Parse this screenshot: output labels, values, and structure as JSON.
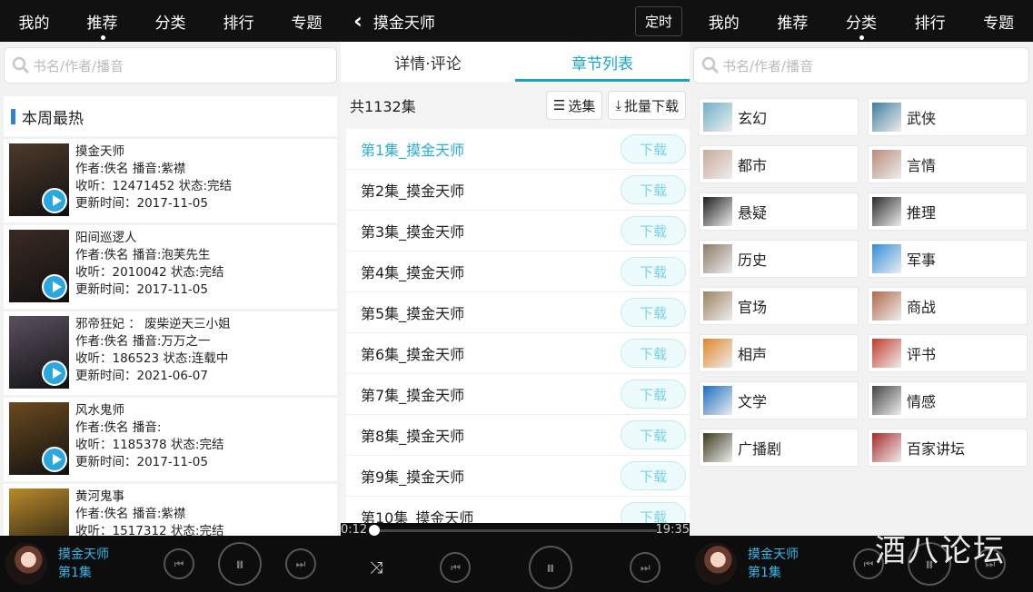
{
  "left": {
    "nav": [
      "我的",
      "推荐",
      "分类",
      "排行",
      "专题"
    ],
    "search_placeholder": "书名/作者/播音",
    "hot_title": "本周最热",
    "books": [
      {
        "title": "摸金天师",
        "author": "作者:佚名 播音:紫襟",
        "listen": "收听：12471452 状态:完结",
        "update": "更新时间：2017-11-05",
        "color": "#4d3a2a"
      },
      {
        "title": "阳间巡逻人",
        "author": "作者:佚名 播音:泡芙先生",
        "listen": "收听：2010042 状态:完结",
        "update": "更新时间：2017-11-05",
        "color": "#3a2a24"
      },
      {
        "title": "邪帝狂妃 ： 废柴逆天三小姐",
        "author": "作者:佚名 播音:万万之一",
        "listen": "收听：186523 状态:连载中",
        "update": "更新时间：2021-06-07",
        "color": "#5a5060"
      },
      {
        "title": "风水鬼师",
        "author": "作者:佚名 播音:",
        "listen": "收听：1185378 状态:完结",
        "update": "更新时间：2017-11-05",
        "color": "#6b4a1e"
      },
      {
        "title": "黄河鬼事",
        "author": "作者:佚名 播音:紫襟",
        "listen": "收听：1517312 状态:完结",
        "update": "",
        "color": "#b98a2a"
      }
    ],
    "player": {
      "title": "摸金天师",
      "episode": "第1集"
    }
  },
  "middle": {
    "title": "摸金天师",
    "timer": "定时",
    "tabs": [
      "详情·评论",
      "章节列表"
    ],
    "count": "共1132集",
    "select_btn": "选集",
    "batch_btn": "批量下载",
    "episodes": [
      "第1集_摸金天师",
      "第2集_摸金天师",
      "第3集_摸金天师",
      "第4集_摸金天师",
      "第5集_摸金天师",
      "第6集_摸金天师",
      "第7集_摸金天师",
      "第8集_摸金天师",
      "第9集_摸金天师",
      "第10集_摸金天师"
    ],
    "download_label": "下载",
    "progress": {
      "current": "0:12",
      "total": "19:35"
    }
  },
  "right": {
    "nav": [
      "我的",
      "推荐",
      "分类",
      "排行",
      "专题"
    ],
    "search_placeholder": "书名/作者/播音",
    "categories": [
      {
        "name": "玄幻",
        "color": "#6fb1c9"
      },
      {
        "name": "武侠",
        "color": "#3e7fa0"
      },
      {
        "name": "都市",
        "color": "#c9a99a"
      },
      {
        "name": "言情",
        "color": "#b98c7a"
      },
      {
        "name": "悬疑",
        "color": "#1e1e1e"
      },
      {
        "name": "推理",
        "color": "#2a2a2a"
      },
      {
        "name": "历史",
        "color": "#8b7b66"
      },
      {
        "name": "军事",
        "color": "#2f8fd8"
      },
      {
        "name": "官场",
        "color": "#9c8460"
      },
      {
        "name": "商战",
        "color": "#b0694a"
      },
      {
        "name": "相声",
        "color": "#e0852a"
      },
      {
        "name": "评书",
        "color": "#c23b2a"
      },
      {
        "name": "文学",
        "color": "#1a6fc0"
      },
      {
        "name": "情感",
        "color": "#444444"
      },
      {
        "name": "广播剧",
        "color": "#3b3a1e"
      },
      {
        "name": "百家讲坛",
        "color": "#a82a2a"
      }
    ],
    "player": {
      "title": "摸金天师",
      "episode": "第1集"
    },
    "watermark": "酒八论坛"
  }
}
